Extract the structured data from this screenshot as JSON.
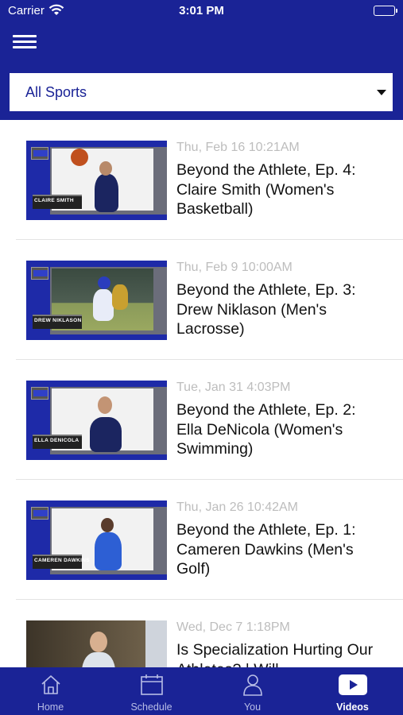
{
  "status_bar": {
    "carrier": "Carrier",
    "time": "3:01 PM"
  },
  "header": {
    "filter": {
      "selected": "All Sports"
    }
  },
  "videos": [
    {
      "date": "Thu, Feb 16 10:21AM",
      "title": "Beyond the Athlete, Ep. 4: Claire Smith (Women's Basketball)",
      "thumbnail_name": "CLAIRE SMITH"
    },
    {
      "date": "Thu, Feb 9 10:00AM",
      "title": "Beyond the Athlete, Ep. 3: Drew Niklason (Men's Lacrosse)",
      "thumbnail_name": "DREW NIKLASON"
    },
    {
      "date": "Tue, Jan 31 4:03PM",
      "title": "Beyond the Athlete, Ep. 2: Ella DeNicola (Women's Swimming)",
      "thumbnail_name": "ELLA DENICOLA"
    },
    {
      "date": "Thu, Jan 26 10:42AM",
      "title": "Beyond the Athlete, Ep. 1: Cameren Dawkins (Men's Golf)",
      "thumbnail_name": "CAMEREN DAWKINS"
    },
    {
      "date": "Wed, Dec 7 1:18PM",
      "title": "Is Specialization Hurting Our Athletes? | Will..."
    }
  ],
  "tabs": [
    {
      "label": "Home",
      "icon": "home-icon",
      "active": false
    },
    {
      "label": "Schedule",
      "icon": "calendar-icon",
      "active": false
    },
    {
      "label": "You",
      "icon": "person-icon",
      "active": false
    },
    {
      "label": "Videos",
      "icon": "play-icon",
      "active": true
    }
  ],
  "colors": {
    "brand_blue": "#1a2396",
    "date_gray": "#bdbdbd"
  }
}
